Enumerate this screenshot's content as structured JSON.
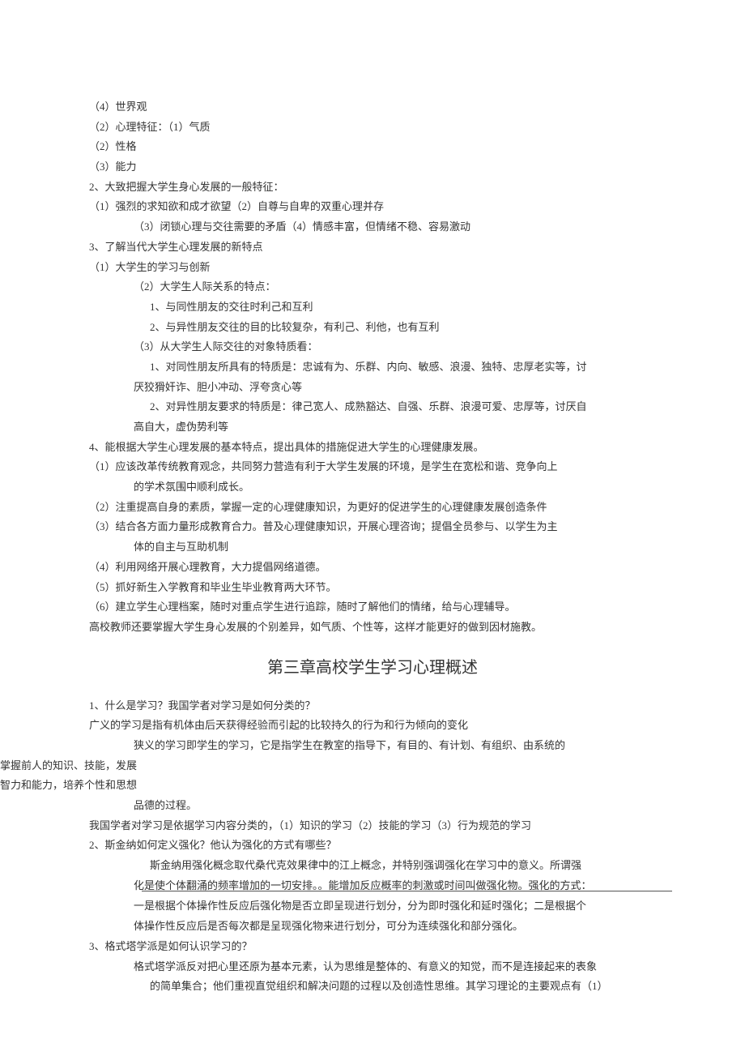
{
  "lines": [
    {
      "cls": "indent-0",
      "text": "（4）世界观"
    },
    {
      "cls": "indent-0",
      "text": "（2）心理特征：（1）气质"
    },
    {
      "cls": "indent-0",
      "text": "（2）性格"
    },
    {
      "cls": "indent-0",
      "text": "（3）能力"
    },
    {
      "cls": "indent-0",
      "text": "2、大致把握大学生身心发展的一般特征："
    },
    {
      "cls": "indent-0",
      "text": "（1）强烈的求知欲和成才欲望（2）自尊与自卑的双重心理并存"
    },
    {
      "cls": "indent-1",
      "text": "（3）闭锁心理与交往需要的矛盾（4）情感丰富，但情绪不稳、容易激动"
    },
    {
      "cls": "indent-0",
      "text": "3、了解当代大学生心理发展的新特点"
    },
    {
      "cls": "indent-0",
      "text": "（1）大学生的学习与创新"
    },
    {
      "cls": "indent-1",
      "text": "（2）大学生人际关系的特点："
    },
    {
      "cls": "indent-2",
      "text": "1、与同性朋友的交往时利己和互利"
    },
    {
      "cls": "indent-2",
      "text": "2、与异性朋友交往的目的比较复杂，有利己、利他，也有互利"
    },
    {
      "cls": "indent-1",
      "text": "（3）从大学生人际交往的对象特质看："
    },
    {
      "cls": "indent-2",
      "text": "1、对同性朋友所具有的特质是：忠诚有为、乐群、内向、敏感、浪漫、独特、忠厚老实等，讨"
    },
    {
      "cls": "indent-1",
      "text": "厌狡猾奸诈、胆小冲动、浮夸贪心等"
    },
    {
      "cls": "indent-2",
      "text": "2、对异性朋友要求的特质是：律己宽人、成熟豁达、自强、乐群、浪漫可爱、忠厚等，讨厌自"
    },
    {
      "cls": "indent-1",
      "text": "高自大，虚伪势利等"
    },
    {
      "cls": "indent-0",
      "text": "4、能根据大学生心理发展的基本特点，提出具体的措施促进大学生的心理健康发展。"
    },
    {
      "cls": "indent-0",
      "text": "（1）应该改革传统教育观念，共同努力营造有利于大学生发展的环境，是学生在宽松和谐、竞争向上"
    },
    {
      "cls": "indent-1",
      "text": "的学术氛围中顺利成长。"
    },
    {
      "cls": "indent-0",
      "text": "（2）注重提高自身的素质，掌握一定的心理健康知识，为更好的促进学生的心理健康发展创造条件"
    },
    {
      "cls": "indent-0",
      "text": "（3）结合各方面力量形成教育合力。普及心理健康知识，开展心理咨询；提倡全员参与、以学生为主"
    },
    {
      "cls": "indent-1",
      "text": "体的自主与互助机制"
    },
    {
      "cls": "indent-0",
      "text": "（4）利用网络开展心理教育，大力提倡网络道德。"
    },
    {
      "cls": "indent-0",
      "text": "（5）抓好新生入学教育和毕业生毕业教育两大环节。"
    },
    {
      "cls": "indent-0",
      "text": "（6）建立学生心理档案，随时对重点学生进行追踪，随时了解他们的情绪，给与心理辅导。"
    },
    {
      "cls": "indent-0",
      "text": "高校教师还要掌握大学生身心发展的个别差异，如气质、个性等，这样才能更好的做到因材施教。"
    }
  ],
  "chapter_title": "第三章高校学生学习心理概述",
  "lines2": [
    {
      "cls": "indent-0",
      "text": "1、什么是学习？我国学者对学习是如何分类的？"
    },
    {
      "cls": "indent-0",
      "text": "广义的学习是指有机体由后天获得经验而引起的比较持久的行为和行为倾向的变化"
    },
    {
      "cls": "indent-1",
      "text": "狭义的学习即学生的学习，它是指学生在教室的指导下，有目的、有计划、有组织、由系统的"
    }
  ],
  "left_block": [
    "掌握前人的知识、技能，发展",
    "智力和能力，培养个性和思想"
  ],
  "lines3": [
    {
      "cls": "indent-1",
      "text": "品德的过程。"
    },
    {
      "cls": "indent-0",
      "text": "我国学者对学习是依据学习内容分类的，（1）知识的学习（2）技能的学习（3）行为规范的学习"
    },
    {
      "cls": "indent-0",
      "text": "2、斯金纳如何定义强化？他认为强化的方式有哪些？"
    },
    {
      "cls": "indent-2",
      "text": "斯金纳用强化概念取代桑代克效果律中的江上概念，并特别强调强化在学习中的意义。所谓强"
    },
    {
      "cls": "indent-1",
      "text": "化是使个体翻涌的频率增加的一切安排。。能增加反应概率的刺激或时间叫做强化物。强化的方式："
    }
  ],
  "lines4": [
    {
      "cls": "indent-1",
      "text": "一是根据个体操作性反应后强化物是否立即呈现进行划分，分为即时强化和延时强化；二是根据个"
    },
    {
      "cls": "indent-1",
      "text": "体操作性反应后是否每次都是呈现强化物来进行划分，可分为连续强化和部分强化。"
    },
    {
      "cls": "indent-0",
      "text": "3、格式塔学派是如何认识学习的？"
    },
    {
      "cls": "indent-1",
      "text": "格式塔学派反对把心里还原为基本元素，认为思维是整体的、有意义的知觉，而不是连接起来的表象"
    },
    {
      "cls": "indent-2",
      "text": "的简单集合；他们重视直觉组织和解决问题的过程以及创造性思维。其学习理论的主要观点有（1）"
    }
  ]
}
